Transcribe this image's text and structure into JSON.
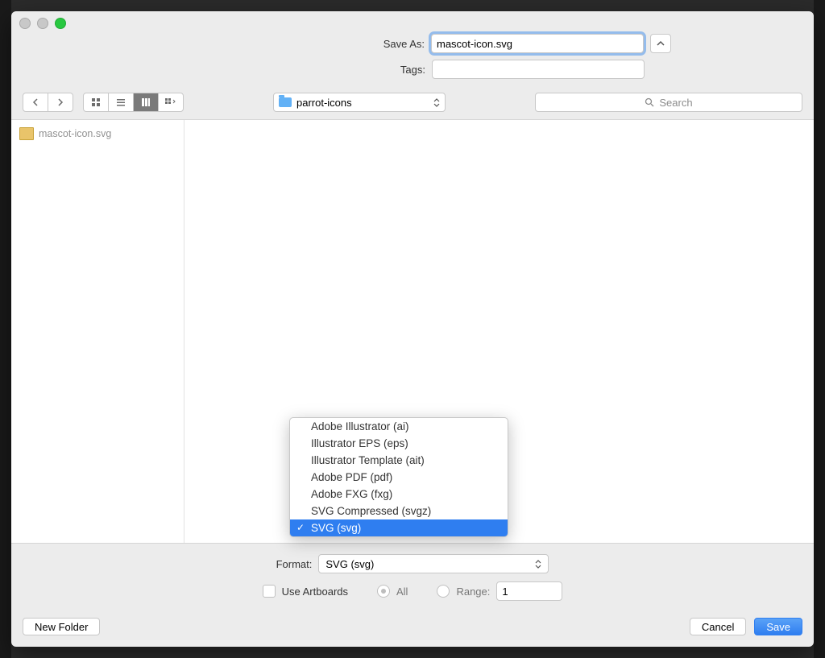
{
  "labels": {
    "save_as": "Save As:",
    "tags": "Tags:",
    "format": "Format:",
    "use_artboards": "Use Artboards",
    "all": "All",
    "range": "Range:"
  },
  "save_as": {
    "value": "mascot-icon.svg",
    "selected_prefix": "mascot-icon"
  },
  "tags_value": "",
  "folder": {
    "name": "parrot-icons"
  },
  "search": {
    "placeholder": "Search"
  },
  "sidebar": {
    "files": [
      {
        "name": "mascot-icon.svg"
      }
    ]
  },
  "format_options": [
    "Adobe Illustrator (ai)",
    "Illustrator EPS (eps)",
    "Illustrator Template (ait)",
    "Adobe PDF (pdf)",
    "Adobe FXG (fxg)",
    "SVG Compressed (svgz)",
    "SVG (svg)"
  ],
  "format_selected_index": 6,
  "range_value": "1",
  "buttons": {
    "new_folder": "New Folder",
    "cancel": "Cancel",
    "save": "Save"
  }
}
